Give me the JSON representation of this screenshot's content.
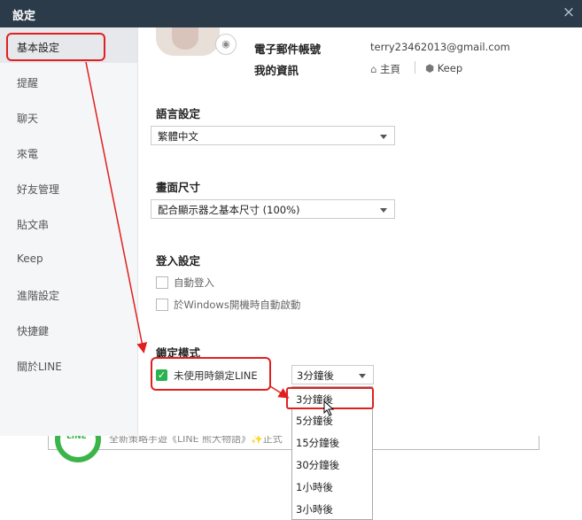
{
  "window": {
    "title": "設定",
    "close_glyph": "×"
  },
  "sidebar": {
    "items": [
      {
        "label": "基本設定",
        "active": true
      },
      {
        "label": "提醒"
      },
      {
        "label": "聊天"
      },
      {
        "label": "來電"
      },
      {
        "label": "好友管理"
      },
      {
        "label": "貼文串"
      },
      {
        "label": "Keep"
      },
      {
        "label": "進階設定"
      },
      {
        "label": "快捷鍵"
      },
      {
        "label": "關於LINE"
      }
    ]
  },
  "profile": {
    "email_label": "電子郵件帳號",
    "email_value": "terry23462013@gmail.com",
    "info_label": "我的資訊",
    "home_link": "主頁",
    "keep_link": "Keep",
    "camera_icon": "camera-icon",
    "home_icon": "home-icon",
    "keep_icon": "keep-icon"
  },
  "language": {
    "heading": "語言設定",
    "value": "繁體中文"
  },
  "screen_size": {
    "heading": "畫面尺寸",
    "value": "配合顯示器之基本尺寸 (100%)"
  },
  "login": {
    "heading": "登入設定",
    "auto_login": "自動登入",
    "auto_start": "於Windows開機時自動啟動"
  },
  "lock": {
    "heading": "鎖定模式",
    "checkbox_label": "未使用時鎖定LINE",
    "checked": true,
    "select_value": "3分鐘後",
    "options": [
      "3分鐘後",
      "5分鐘後",
      "15分鐘後",
      "30分鐘後",
      "1小時後",
      "3小時後"
    ],
    "selected_index": 0
  },
  "background": {
    "logo_text": "LINE",
    "banner_text": "全新策略手遊《LINE 熊大物語》✨正式"
  },
  "colors": {
    "titlebar": "#2b3b4a",
    "accent_green": "#2ab150",
    "annotation_red": "#e02020"
  }
}
